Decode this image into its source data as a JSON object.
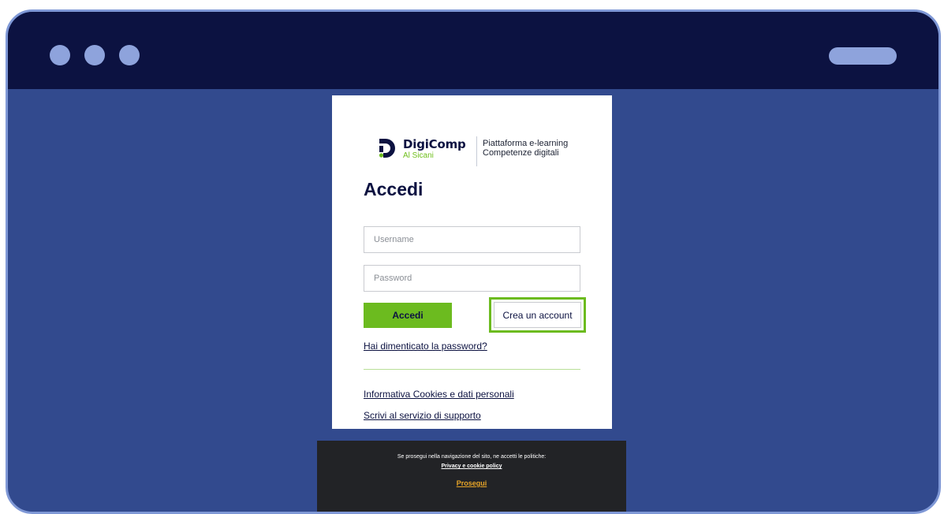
{
  "brand": {
    "name": "DigiComp",
    "sub": "Al Sicani",
    "tagline_line1": "Piattaforma e-learning",
    "tagline_line2": "Competenze digitali"
  },
  "login": {
    "title": "Accedi",
    "username_placeholder": "Username",
    "password_placeholder": "Password",
    "submit_label": "Accedi",
    "create_account_label": "Crea un account",
    "forgot_password_link": "Hai dimenticato la password?",
    "cookies_link": "Informativa Cookies e dati personali",
    "support_link": "Scrivi al servizio di supporto"
  },
  "cookie_bar": {
    "text": "Se prosegui nella navigazione del sito, ne accetti le politiche:",
    "policy_link": "Privacy e cookie policy",
    "continue_link": "Prosegui"
  },
  "colors": {
    "titlebar": "#0c1241",
    "page_background": "#324a8e",
    "accent_green": "#6cbb1f",
    "window_controls": "#8ea3dc"
  },
  "icons": {
    "logo": "digicomp-logo-icon"
  }
}
